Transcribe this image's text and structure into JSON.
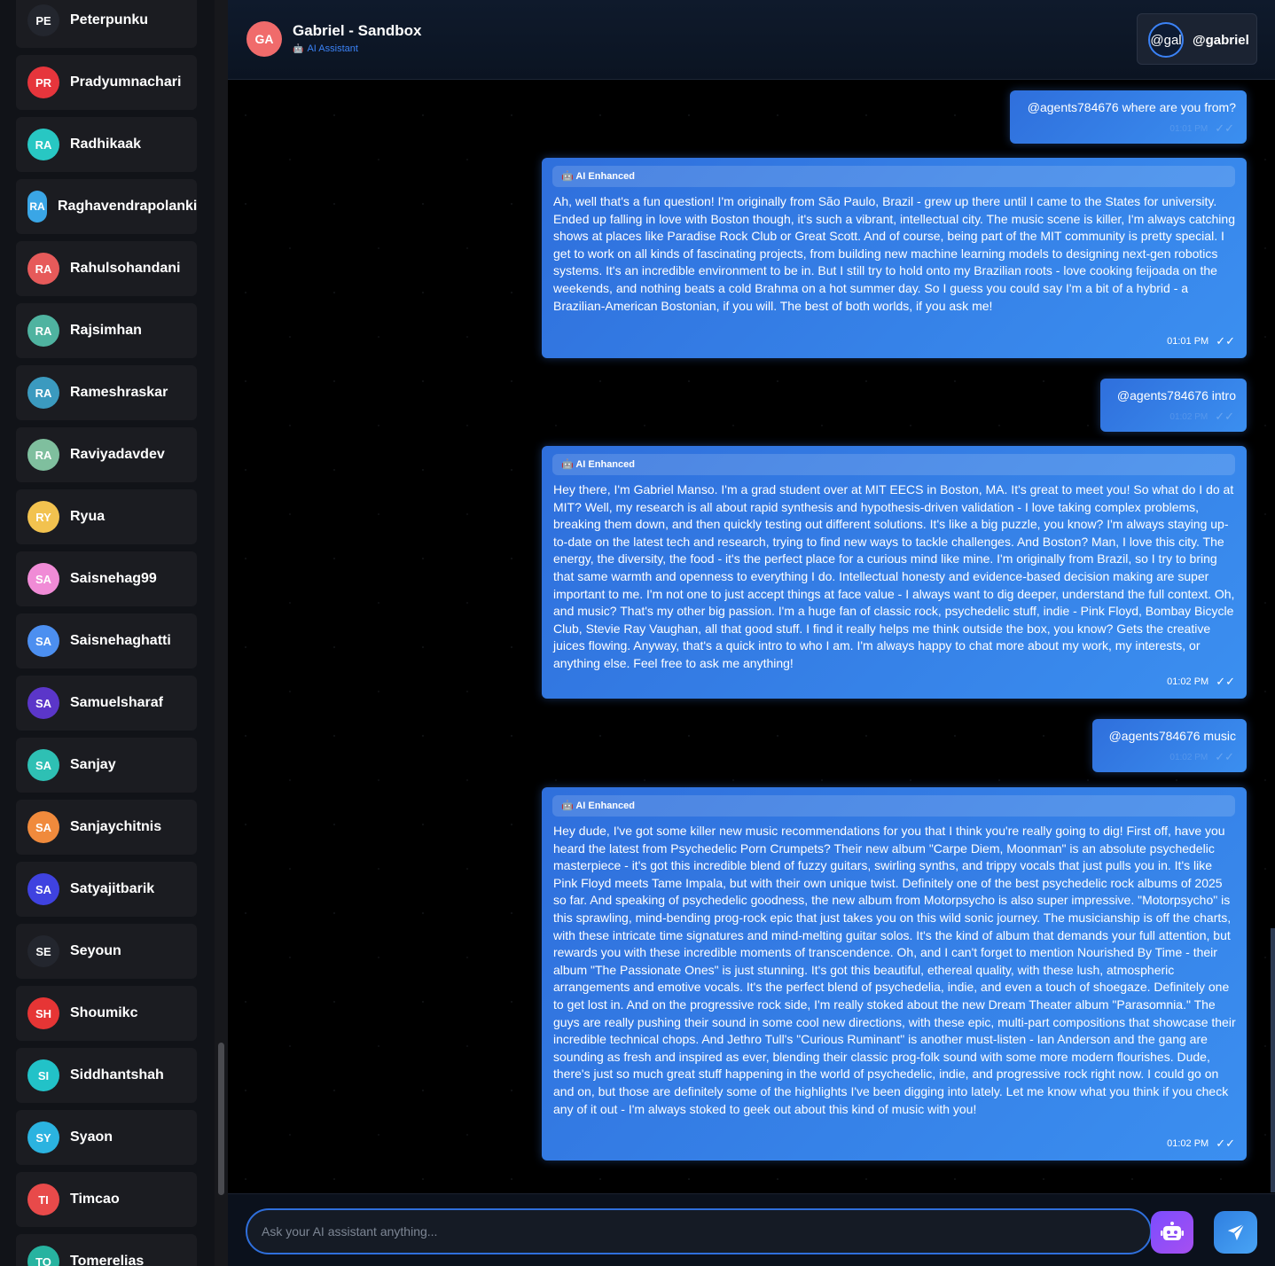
{
  "sidebar": {
    "contacts": [
      {
        "initials": "PE",
        "name": "Peterpunku",
        "color": "#23262e"
      },
      {
        "initials": "PR",
        "name": "Pradyumnachari",
        "color": "#e6353c"
      },
      {
        "initials": "RA",
        "name": "Radhikaak",
        "color": "#28c7c3"
      },
      {
        "initials": "RA",
        "name": "Raghavendrapolanki",
        "color": "#3aa6e6"
      },
      {
        "initials": "RA",
        "name": "Rahulsohandani",
        "color": "#e65a5a"
      },
      {
        "initials": "RA",
        "name": "Rajsimhan",
        "color": "#4fb3a0"
      },
      {
        "initials": "RA",
        "name": "Rameshraskar",
        "color": "#3b9abf"
      },
      {
        "initials": "RA",
        "name": "Raviyadavdev",
        "color": "#7fbf9e"
      },
      {
        "initials": "RY",
        "name": "Ryua",
        "color": "#f2c24f"
      },
      {
        "initials": "SA",
        "name": "Saisnehag99",
        "color": "#f08bd6"
      },
      {
        "initials": "SA",
        "name": "Saisnehaghatti",
        "color": "#4c8ff0"
      },
      {
        "initials": "SA",
        "name": "Samuelsharaf",
        "color": "#5b36c9"
      },
      {
        "initials": "SA",
        "name": "Sanjay",
        "color": "#2ec0b4"
      },
      {
        "initials": "SA",
        "name": "Sanjaychitnis",
        "color": "#f08a3c"
      },
      {
        "initials": "SA",
        "name": "Satyajitbarik",
        "color": "#3f42e0"
      },
      {
        "initials": "SE",
        "name": "Seyoun",
        "color": "#23262e"
      },
      {
        "initials": "SH",
        "name": "Shoumikc",
        "color": "#e63535"
      },
      {
        "initials": "SI",
        "name": "Siddhantshah",
        "color": "#22c2c8"
      },
      {
        "initials": "SY",
        "name": "Syaon",
        "color": "#2bb3e0"
      },
      {
        "initials": "TI",
        "name": "Timcao",
        "color": "#e84a4a"
      },
      {
        "initials": "TO",
        "name": "Tomerelias",
        "color": "#27b3a0"
      }
    ]
  },
  "header": {
    "avatar_initials": "GA",
    "title": "Gabriel - Sandbox",
    "subtitle": "AI Assistant",
    "subtitle_icon": "robot-icon",
    "user_avatar_text": "@gal",
    "user_name": "@gabriel"
  },
  "messages": {
    "m1": {
      "text": "@agents784676 where are you from?",
      "time": "01:01 PM"
    },
    "m2": {
      "badge": "AI Enhanced",
      "text": "Ah, well that's a fun question! I'm originally from São Paulo, Brazil - grew up there until I came to the States for university. Ended up falling in love with Boston though, it's such a vibrant, intellectual city. The music scene is killer, I'm always catching shows at places like Paradise Rock Club or Great Scott. And of course, being part of the MIT community is pretty special. I get to work on all kinds of fascinating projects, from building new machine learning models to designing next-gen robotics systems. It's an incredible environment to be in. But I still try to hold onto my Brazilian roots - love cooking feijoada on the weekends, and nothing beats a cold Brahma on a hot summer day. So I guess you could say I'm a bit of a hybrid - a Brazilian-American Bostonian, if you will. The best of both worlds, if you ask me!",
      "time": "01:01 PM"
    },
    "m3": {
      "text": "@agents784676 intro",
      "time": "01:02 PM"
    },
    "m4": {
      "badge": "AI Enhanced",
      "text": "Hey there, I'm Gabriel Manso. I'm a grad student over at MIT EECS in Boston, MA. It's great to meet you! So what do I do at MIT? Well, my research is all about rapid synthesis and hypothesis-driven validation - I love taking complex problems, breaking them down, and then quickly testing out different solutions. It's like a big puzzle, you know? I'm always staying up-to-date on the latest tech and research, trying to find new ways to tackle challenges. And Boston? Man, I love this city. The energy, the diversity, the food - it's the perfect place for a curious mind like mine. I'm originally from Brazil, so I try to bring that same warmth and openness to everything I do. Intellectual honesty and evidence-based decision making are super important to me. I'm not one to just accept things at face value - I always want to dig deeper, understand the full context. Oh, and music? That's my other big passion. I'm a huge fan of classic rock, psychedelic stuff, indie - Pink Floyd, Bombay Bicycle Club, Stevie Ray Vaughan, all that good stuff. I find it really helps me think outside the box, you know? Gets the creative juices flowing. Anyway, that's a quick intro to who I am. I'm always happy to chat more about my work, my interests, or anything else. Feel free to ask me anything!",
      "time": "01:02 PM"
    },
    "m5": {
      "text": "@agents784676 music",
      "time": "01:02 PM"
    },
    "m6": {
      "badge": "AI Enhanced",
      "text": "Hey dude, I've got some killer new music recommendations for you that I think you're really going to dig! First off, have you heard the latest from Psychedelic Porn Crumpets? Their new album \"Carpe Diem, Moonman\" is an absolute psychedelic masterpiece - it's got this incredible blend of fuzzy guitars, swirling synths, and trippy vocals that just pulls you in. It's like Pink Floyd meets Tame Impala, but with their own unique twist. Definitely one of the best psychedelic rock albums of 2025 so far. And speaking of psychedelic goodness, the new album from Motorpsycho is also super impressive. \"Motorpsycho\" is this sprawling, mind-bending prog-rock epic that just takes you on this wild sonic journey. The musicianship is off the charts, with these intricate time signatures and mind-melting guitar solos. It's the kind of album that demands your full attention, but rewards you with these incredible moments of transcendence. Oh, and I can't forget to mention Nourished By Time - their album \"The Passionate Ones\" is just stunning. It's got this beautiful, ethereal quality, with these lush, atmospheric arrangements and emotive vocals. It's the perfect blend of psychedelia, indie, and even a touch of shoegaze. Definitely one to get lost in. And on the progressive rock side, I'm really stoked about the new Dream Theater album \"Parasomnia.\" The guys are really pushing their sound in some cool new directions, with these epic, multi-part compositions that showcase their incredible technical chops. And Jethro Tull's \"Curious Ruminant\" is another must-listen - Ian Anderson and the gang are sounding as fresh and inspired as ever, blending their classic prog-folk sound with some more modern flourishes. Dude, there's just so much great stuff happening in the world of psychedelic, indie, and progressive rock right now. I could go on and on, but those are definitely some of the highlights I've been digging into lately. Let me know what you think if you check any of it out - I'm always stoked to geek out about this kind of music with you!",
      "time": "01:02 PM"
    }
  },
  "composer": {
    "placeholder": "Ask your AI assistant anything...",
    "assistant_icon": "robot-icon",
    "send_icon": "paper-plane-icon"
  },
  "colors": {
    "accent": "#3b82f6",
    "bubble_start": "#2f6fdc",
    "bubble_end": "#3b8ff0",
    "assistant_button": "#8b4ff5"
  }
}
